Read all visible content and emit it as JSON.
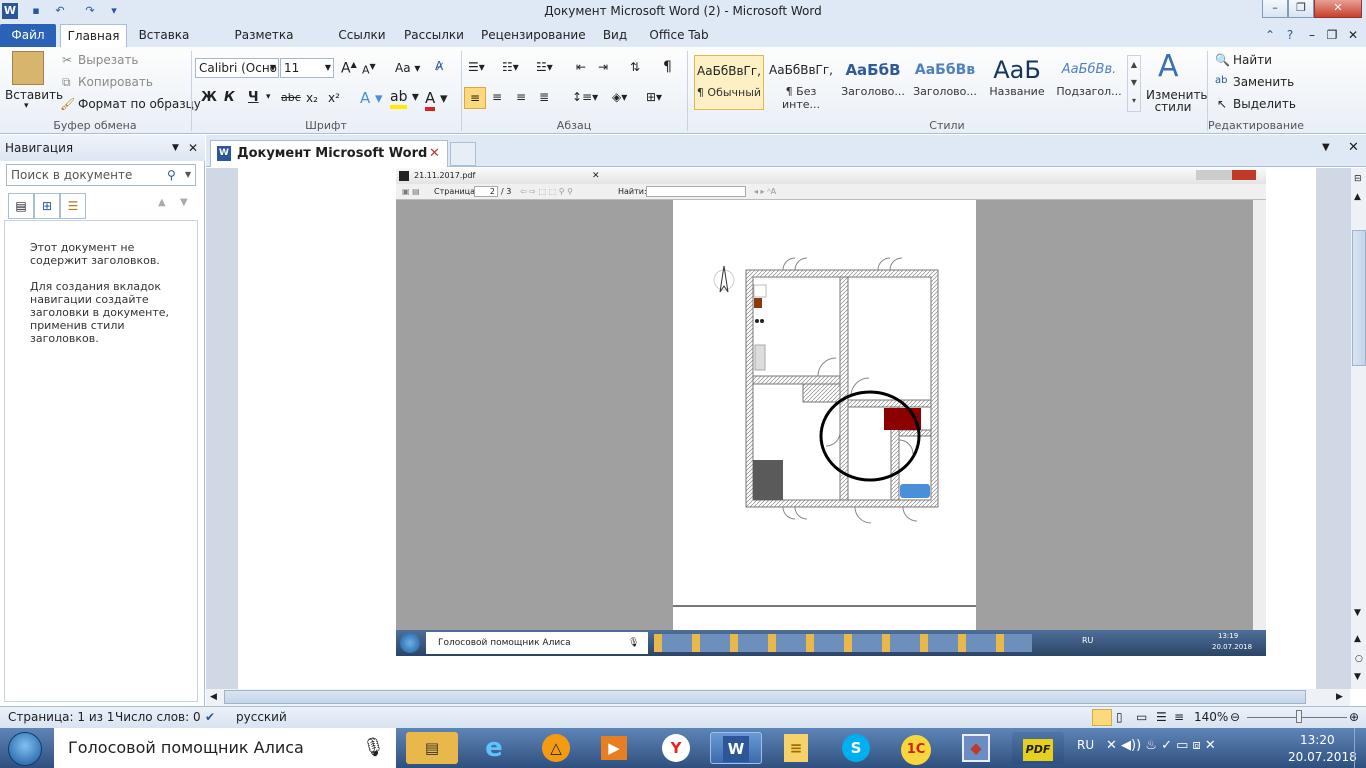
{
  "window": {
    "title": "Документ Microsoft Word (2)  -  Microsoft Word"
  },
  "quick_access": {
    "app_icon": "word-icon",
    "save": "save-icon",
    "undo": "undo-icon",
    "redo": "redo-icon"
  },
  "ribbon_tabs": [
    "Файл",
    "Главная",
    "Вставка",
    "Разметка страницы",
    "Ссылки",
    "Рассылки",
    "Рецензирование",
    "Вид",
    "Office Tab"
  ],
  "clipboard": {
    "paste": "Вставить",
    "cut": "Вырезать",
    "copy": "Копировать",
    "format_painter": "Формат по образцу",
    "label": "Буфер обмена"
  },
  "font": {
    "name": "Calibri (Осно",
    "size": "11",
    "label": "Шрифт",
    "bold": "Ж",
    "italic": "К",
    "underline": "Ч",
    "strike": "abc",
    "sub": "x₂",
    "sup": "x²",
    "grow": "A",
    "shrink": "A",
    "case": "Aa"
  },
  "paragraph": {
    "label": "Абзац",
    "pilcrow": "¶"
  },
  "styles": {
    "label": "Стили",
    "items": [
      {
        "preview": "АаБбВвГг,",
        "name": "¶ Обычный"
      },
      {
        "preview": "АаБбВвГг,",
        "name": "¶ Без инте..."
      },
      {
        "preview": "АаБбВ",
        "name": "Заголово..."
      },
      {
        "preview": "АаБбВв",
        "name": "Заголово..."
      },
      {
        "preview": "АаБ",
        "name": "Название"
      },
      {
        "preview": "АаБбВв.",
        "name": "Подзагол..."
      }
    ],
    "change": "Изменить стили"
  },
  "editing": {
    "label": "Редактирование",
    "find": "Найти",
    "replace": "Заменить",
    "select": "Выделить"
  },
  "nav": {
    "title": "Навигация",
    "search_placeholder": "Поиск в документе",
    "msg1": "Этот документ не содержит заголовков.",
    "msg2": "Для создания вкладок навигации создайте заголовки в документе, применив стили заголовков."
  },
  "doc_tab": {
    "title": "Документ Microsoft Word (2)"
  },
  "pdf": {
    "filename": "21.11.2017.pdf",
    "page_label": "Страница:",
    "page_current": "2",
    "page_total": "/ 3",
    "find_label": "Найти:",
    "taskbar_alice": "Голосовой помощник Алиса",
    "lang": "RU",
    "time": "13:19",
    "date": "20.07.2018"
  },
  "status": {
    "page": "Страница: 1 из 1",
    "words": "Число слов: 0",
    "lang": "русский",
    "zoom": "140%"
  },
  "taskbar": {
    "alice": "Голосовой помощник Алиса",
    "lang": "RU",
    "time": "13:20",
    "date": "20.07.2018",
    "apps": [
      "explorer",
      "ie",
      "avast",
      "media",
      "yandex",
      "word",
      "wordpad",
      "skype",
      "1c",
      "virtualbox",
      "pdf"
    ]
  }
}
